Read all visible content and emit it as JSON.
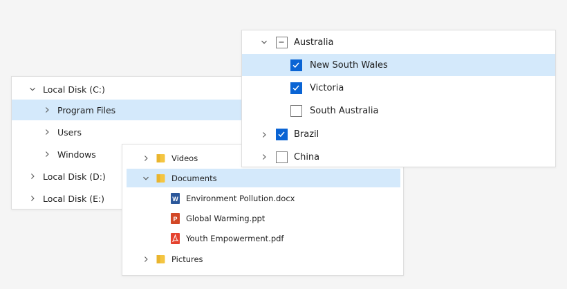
{
  "disk_tree": {
    "items": [
      {
        "label": "Local Disk (C:)",
        "state": "expanded"
      },
      {
        "label": "Program Files",
        "state": "collapsed",
        "selected": true
      },
      {
        "label": "Users",
        "state": "collapsed"
      },
      {
        "label": "Windows",
        "state": "collapsed"
      },
      {
        "label": "Local Disk (D:)",
        "state": "collapsed"
      },
      {
        "label": "Local Disk (E:)",
        "state": "collapsed"
      }
    ]
  },
  "file_tree": {
    "items": [
      {
        "label": "Videos",
        "icon": "folder-icon",
        "state": "collapsed"
      },
      {
        "label": "Documents",
        "icon": "folder-icon",
        "state": "expanded",
        "selected": true
      },
      {
        "label": "Environment Pollution.docx",
        "icon": "word-document-icon"
      },
      {
        "label": "Global Warming.ppt",
        "icon": "powerpoint-document-icon"
      },
      {
        "label": "Youth Empowerment.pdf",
        "icon": "pdf-document-icon"
      },
      {
        "label": "Pictures",
        "icon": "folder-icon",
        "state": "collapsed"
      }
    ]
  },
  "check_tree": {
    "items": [
      {
        "label": "Australia",
        "check": "indeterminate",
        "state": "expanded"
      },
      {
        "label": "New South Wales",
        "check": "checked",
        "selected": true
      },
      {
        "label": "Victoria",
        "check": "checked"
      },
      {
        "label": "South Australia",
        "check": "unchecked"
      },
      {
        "label": "Brazil",
        "check": "checked",
        "state": "collapsed"
      },
      {
        "label": "China",
        "check": "unchecked",
        "state": "collapsed"
      }
    ]
  },
  "colors": {
    "selection": "#d4e9fb",
    "checkbox_accent": "#0a64d4",
    "folder": "#f4c542",
    "word": "#2b579a",
    "powerpoint": "#d24726",
    "pdf": "#e5432f"
  }
}
